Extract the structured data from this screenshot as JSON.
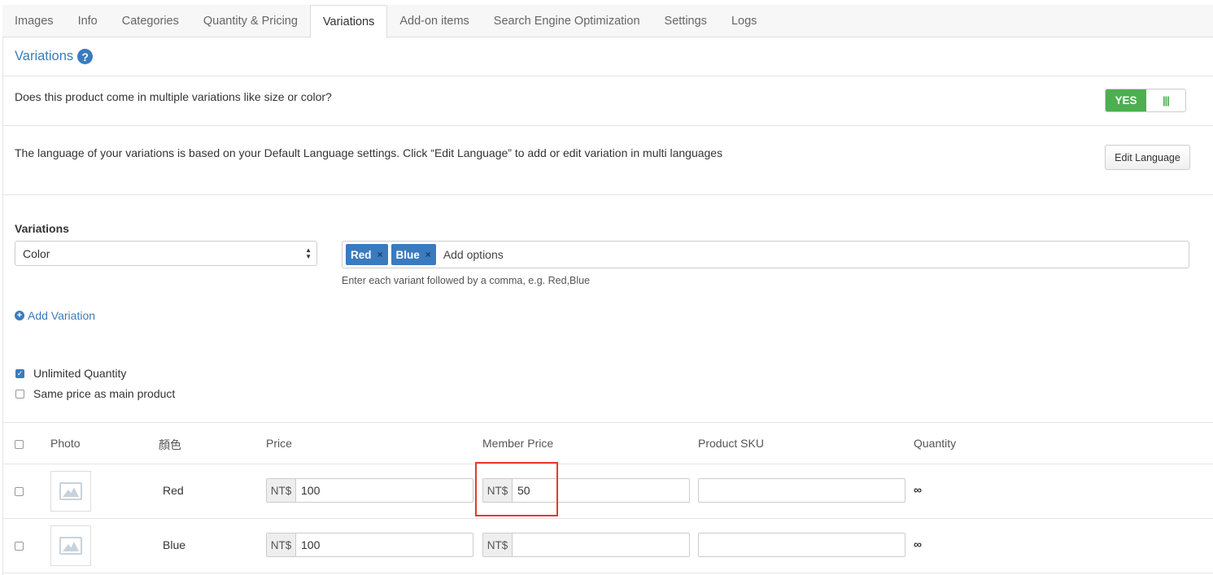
{
  "tabs": [
    {
      "label": "Images"
    },
    {
      "label": "Info"
    },
    {
      "label": "Categories"
    },
    {
      "label": "Quantity & Pricing"
    },
    {
      "label": "Variations",
      "active": true
    },
    {
      "label": "Add-on items"
    },
    {
      "label": "Search Engine Optimization"
    },
    {
      "label": "Settings"
    },
    {
      "label": "Logs"
    }
  ],
  "section": {
    "title": "Variations",
    "help_icon": "question-circle-icon"
  },
  "multiple_variations": {
    "question": "Does this product come in multiple variations like size or color?",
    "toggle_label": "YES",
    "toggle_handle": "|||"
  },
  "language": {
    "text": "The language of your variations is based on your Default Language settings. Click “Edit Language” to add or edit variation in multi languages",
    "button": "Edit Language"
  },
  "variations": {
    "label": "Variations",
    "select_value": "Color",
    "tags": [
      "Red",
      "Blue"
    ],
    "tag_remove": "×",
    "input_placeholder": "Add options",
    "hint": "Enter each variant followed by a comma, e.g. Red,Blue",
    "add_label": "Add Variation"
  },
  "options": {
    "unlimited_quantity": {
      "label": "Unlimited Quantity",
      "checked": true
    },
    "same_price": {
      "label": "Same price as main product",
      "checked": false
    }
  },
  "table": {
    "headers": {
      "photo": "Photo",
      "color": "顏色",
      "price": "Price",
      "member_price": "Member Price",
      "sku": "Product SKU",
      "quantity": "Quantity"
    },
    "currency": "NT$",
    "rows": [
      {
        "name": "Red",
        "price": "100",
        "member_price": "50",
        "sku": "",
        "quantity": "∞"
      },
      {
        "name": "Blue",
        "price": "100",
        "member_price": "",
        "sku": "",
        "quantity": "∞"
      }
    ]
  },
  "colors": {
    "accent": "#3a7bbf",
    "toggle_on": "#4caf50",
    "highlight": "#e53935"
  }
}
